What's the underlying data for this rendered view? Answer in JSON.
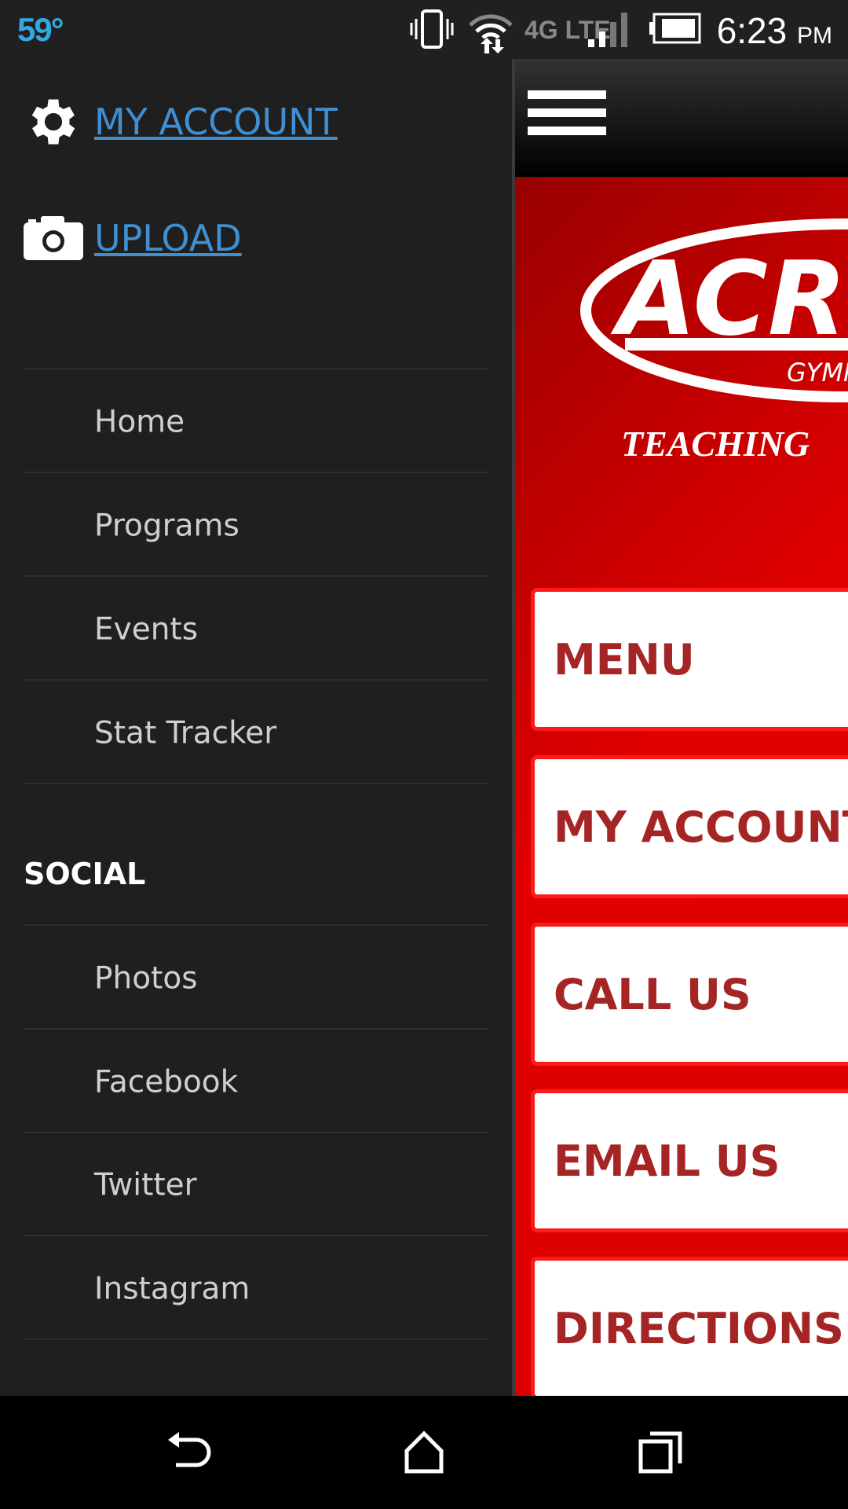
{
  "status_bar": {
    "temperature": "59°",
    "time": "6:23",
    "ampm": "PM",
    "network": "4G LTE"
  },
  "drawer": {
    "account_links": [
      {
        "label": "MY ACCOUNT",
        "icon": "gear-icon"
      },
      {
        "label": "UPLOAD",
        "icon": "camera-icon"
      }
    ],
    "nav_items": [
      "Home",
      "Programs",
      "Events",
      "Stat Tracker"
    ],
    "social_heading": "SOCIAL",
    "social_items": [
      "Photos",
      "Facebook",
      "Twitter",
      "Instagram"
    ]
  },
  "main": {
    "logo_text": "ACRO GYMNASTICS",
    "tagline": "TEACHING",
    "buttons": [
      "MENU",
      "MY ACCOUNT",
      "CALL US",
      "EMAIL US",
      "DIRECTIONS"
    ]
  },
  "colors": {
    "link": "#3f8fd2",
    "accent_red": "#e00000",
    "button_text": "#a52525"
  }
}
